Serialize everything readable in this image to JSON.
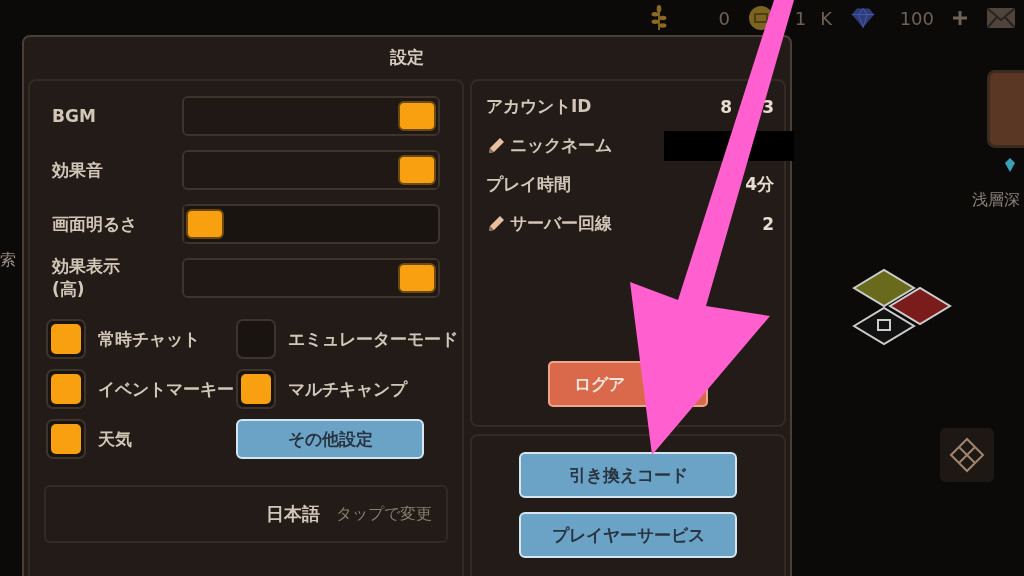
{
  "top_bar": {
    "resources": [
      {
        "kind": "wheat",
        "value_parts": [
          "0"
        ]
      },
      {
        "kind": "coin",
        "value_parts": [
          "1",
          "K"
        ]
      },
      {
        "kind": "gem",
        "value_parts": [
          "100"
        ]
      }
    ]
  },
  "background": {
    "left_edge_text": "索",
    "right_label": "浅層深"
  },
  "dialog": {
    "title": "設定",
    "sliders": [
      {
        "label": "BGM",
        "level": 1
      },
      {
        "label": "効果音",
        "level": 1
      },
      {
        "label": "画面明るさ",
        "level": 0
      },
      {
        "label": "効果表示\n(高)",
        "level": 1
      }
    ],
    "checkboxes": [
      {
        "label": "常時チャット",
        "checked": true
      },
      {
        "label": "エミュレーターモード",
        "checked": false
      },
      {
        "label": "イベントマーキー",
        "checked": true
      },
      {
        "label": "マルチキャンプ",
        "checked": true
      },
      {
        "label": "天気",
        "checked": true
      }
    ],
    "other_settings_button": "その他設定",
    "language": {
      "value": "日本語",
      "hint": "タップで変更"
    },
    "account": [
      {
        "label": "アカウントID",
        "kind": "plain",
        "value_parts": [
          "8",
          "3"
        ]
      },
      {
        "label": "ニックネーム",
        "kind": "editable"
      },
      {
        "label": "プレイ時間",
        "kind": "plain",
        "value_parts": [
          "4分"
        ]
      },
      {
        "label": "サーバー回線",
        "kind": "editable",
        "value_parts": [
          "2"
        ]
      }
    ],
    "logout_button": "ログア",
    "buttons": [
      "引き換えコード",
      "プレイヤーサービス"
    ]
  }
}
